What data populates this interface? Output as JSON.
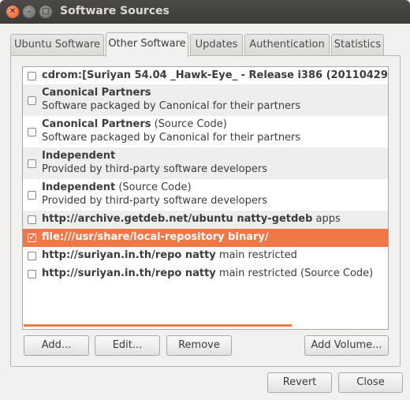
{
  "window": {
    "title": "Software Sources"
  },
  "window_controls": {
    "close": "✕",
    "minimize": "–",
    "maximize": "□"
  },
  "tabs": [
    {
      "label": "Ubuntu Software"
    },
    {
      "label": "Other Software"
    },
    {
      "label": "Updates"
    },
    {
      "label": "Authentication"
    },
    {
      "label": "Statistics"
    }
  ],
  "active_tab": "Other Software",
  "sources": [
    {
      "checked": false,
      "title": "cdrom:[Suriyan 54.04 _Hawk-Eye_ - Release i386 (20110429",
      "title_extra": "",
      "subtitle": ""
    },
    {
      "checked": false,
      "title": "Canonical Partners",
      "title_extra": "",
      "subtitle": "Software packaged by Canonical for their partners"
    },
    {
      "checked": false,
      "title": "Canonical Partners",
      "title_extra": " (Source Code)",
      "subtitle": "Software packaged by Canonical for their partners"
    },
    {
      "checked": false,
      "title": "Independent",
      "title_extra": "",
      "subtitle": "Provided by third-party software developers"
    },
    {
      "checked": false,
      "title": "Independent",
      "title_extra": " (Source Code)",
      "subtitle": "Provided by third-party software developers"
    },
    {
      "checked": false,
      "title": "http://archive.getdeb.net/ubuntu natty-getdeb",
      "title_extra": " apps",
      "subtitle": ""
    },
    {
      "checked": true,
      "title": "file:///usr/share/local-repository binary/",
      "title_extra": "",
      "subtitle": ""
    },
    {
      "checked": false,
      "title": "http://suriyan.in.th/repo natty",
      "title_extra": " main restricted",
      "subtitle": ""
    },
    {
      "checked": false,
      "title": "http://suriyan.in.th/repo natty",
      "title_extra": " main restricted (Source Code)",
      "subtitle": ""
    }
  ],
  "buttons": {
    "add": "Add...",
    "edit": "Edit...",
    "remove": "Remove",
    "add_volume": "Add Volume...",
    "revert": "Revert",
    "close": "Close"
  },
  "colors": {
    "accent": "#f07746",
    "titlebar": "#3c3b37"
  }
}
